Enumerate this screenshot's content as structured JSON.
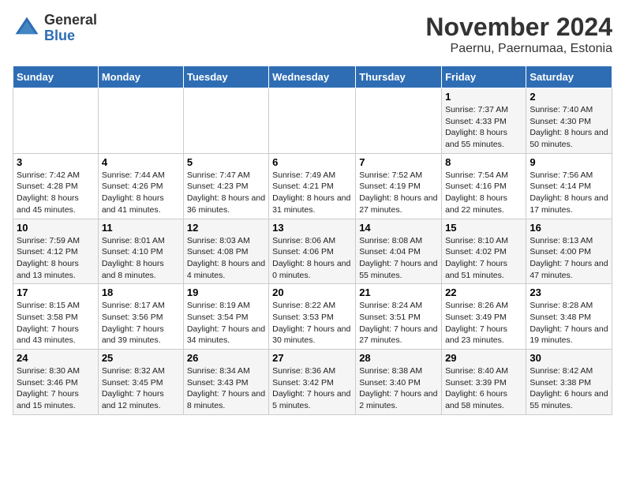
{
  "header": {
    "logo": {
      "general": "General",
      "blue": "Blue"
    },
    "title": "November 2024",
    "location": "Paernu, Paernumaa, Estonia"
  },
  "weekdays": [
    "Sunday",
    "Monday",
    "Tuesday",
    "Wednesday",
    "Thursday",
    "Friday",
    "Saturday"
  ],
  "weeks": [
    [
      {
        "day": "",
        "sunrise": "",
        "sunset": "",
        "daylight": ""
      },
      {
        "day": "",
        "sunrise": "",
        "sunset": "",
        "daylight": ""
      },
      {
        "day": "",
        "sunrise": "",
        "sunset": "",
        "daylight": ""
      },
      {
        "day": "",
        "sunrise": "",
        "sunset": "",
        "daylight": ""
      },
      {
        "day": "",
        "sunrise": "",
        "sunset": "",
        "daylight": ""
      },
      {
        "day": "1",
        "sunrise": "Sunrise: 7:37 AM",
        "sunset": "Sunset: 4:33 PM",
        "daylight": "Daylight: 8 hours and 55 minutes."
      },
      {
        "day": "2",
        "sunrise": "Sunrise: 7:40 AM",
        "sunset": "Sunset: 4:30 PM",
        "daylight": "Daylight: 8 hours and 50 minutes."
      }
    ],
    [
      {
        "day": "3",
        "sunrise": "Sunrise: 7:42 AM",
        "sunset": "Sunset: 4:28 PM",
        "daylight": "Daylight: 8 hours and 45 minutes."
      },
      {
        "day": "4",
        "sunrise": "Sunrise: 7:44 AM",
        "sunset": "Sunset: 4:26 PM",
        "daylight": "Daylight: 8 hours and 41 minutes."
      },
      {
        "day": "5",
        "sunrise": "Sunrise: 7:47 AM",
        "sunset": "Sunset: 4:23 PM",
        "daylight": "Daylight: 8 hours and 36 minutes."
      },
      {
        "day": "6",
        "sunrise": "Sunrise: 7:49 AM",
        "sunset": "Sunset: 4:21 PM",
        "daylight": "Daylight: 8 hours and 31 minutes."
      },
      {
        "day": "7",
        "sunrise": "Sunrise: 7:52 AM",
        "sunset": "Sunset: 4:19 PM",
        "daylight": "Daylight: 8 hours and 27 minutes."
      },
      {
        "day": "8",
        "sunrise": "Sunrise: 7:54 AM",
        "sunset": "Sunset: 4:16 PM",
        "daylight": "Daylight: 8 hours and 22 minutes."
      },
      {
        "day": "9",
        "sunrise": "Sunrise: 7:56 AM",
        "sunset": "Sunset: 4:14 PM",
        "daylight": "Daylight: 8 hours and 17 minutes."
      }
    ],
    [
      {
        "day": "10",
        "sunrise": "Sunrise: 7:59 AM",
        "sunset": "Sunset: 4:12 PM",
        "daylight": "Daylight: 8 hours and 13 minutes."
      },
      {
        "day": "11",
        "sunrise": "Sunrise: 8:01 AM",
        "sunset": "Sunset: 4:10 PM",
        "daylight": "Daylight: 8 hours and 8 minutes."
      },
      {
        "day": "12",
        "sunrise": "Sunrise: 8:03 AM",
        "sunset": "Sunset: 4:08 PM",
        "daylight": "Daylight: 8 hours and 4 minutes."
      },
      {
        "day": "13",
        "sunrise": "Sunrise: 8:06 AM",
        "sunset": "Sunset: 4:06 PM",
        "daylight": "Daylight: 8 hours and 0 minutes."
      },
      {
        "day": "14",
        "sunrise": "Sunrise: 8:08 AM",
        "sunset": "Sunset: 4:04 PM",
        "daylight": "Daylight: 7 hours and 55 minutes."
      },
      {
        "day": "15",
        "sunrise": "Sunrise: 8:10 AM",
        "sunset": "Sunset: 4:02 PM",
        "daylight": "Daylight: 7 hours and 51 minutes."
      },
      {
        "day": "16",
        "sunrise": "Sunrise: 8:13 AM",
        "sunset": "Sunset: 4:00 PM",
        "daylight": "Daylight: 7 hours and 47 minutes."
      }
    ],
    [
      {
        "day": "17",
        "sunrise": "Sunrise: 8:15 AM",
        "sunset": "Sunset: 3:58 PM",
        "daylight": "Daylight: 7 hours and 43 minutes."
      },
      {
        "day": "18",
        "sunrise": "Sunrise: 8:17 AM",
        "sunset": "Sunset: 3:56 PM",
        "daylight": "Daylight: 7 hours and 39 minutes."
      },
      {
        "day": "19",
        "sunrise": "Sunrise: 8:19 AM",
        "sunset": "Sunset: 3:54 PM",
        "daylight": "Daylight: 7 hours and 34 minutes."
      },
      {
        "day": "20",
        "sunrise": "Sunrise: 8:22 AM",
        "sunset": "Sunset: 3:53 PM",
        "daylight": "Daylight: 7 hours and 30 minutes."
      },
      {
        "day": "21",
        "sunrise": "Sunrise: 8:24 AM",
        "sunset": "Sunset: 3:51 PM",
        "daylight": "Daylight: 7 hours and 27 minutes."
      },
      {
        "day": "22",
        "sunrise": "Sunrise: 8:26 AM",
        "sunset": "Sunset: 3:49 PM",
        "daylight": "Daylight: 7 hours and 23 minutes."
      },
      {
        "day": "23",
        "sunrise": "Sunrise: 8:28 AM",
        "sunset": "Sunset: 3:48 PM",
        "daylight": "Daylight: 7 hours and 19 minutes."
      }
    ],
    [
      {
        "day": "24",
        "sunrise": "Sunrise: 8:30 AM",
        "sunset": "Sunset: 3:46 PM",
        "daylight": "Daylight: 7 hours and 15 minutes."
      },
      {
        "day": "25",
        "sunrise": "Sunrise: 8:32 AM",
        "sunset": "Sunset: 3:45 PM",
        "daylight": "Daylight: 7 hours and 12 minutes."
      },
      {
        "day": "26",
        "sunrise": "Sunrise: 8:34 AM",
        "sunset": "Sunset: 3:43 PM",
        "daylight": "Daylight: 7 hours and 8 minutes."
      },
      {
        "day": "27",
        "sunrise": "Sunrise: 8:36 AM",
        "sunset": "Sunset: 3:42 PM",
        "daylight": "Daylight: 7 hours and 5 minutes."
      },
      {
        "day": "28",
        "sunrise": "Sunrise: 8:38 AM",
        "sunset": "Sunset: 3:40 PM",
        "daylight": "Daylight: 7 hours and 2 minutes."
      },
      {
        "day": "29",
        "sunrise": "Sunrise: 8:40 AM",
        "sunset": "Sunset: 3:39 PM",
        "daylight": "Daylight: 6 hours and 58 minutes."
      },
      {
        "day": "30",
        "sunrise": "Sunrise: 8:42 AM",
        "sunset": "Sunset: 3:38 PM",
        "daylight": "Daylight: 6 hours and 55 minutes."
      }
    ]
  ]
}
